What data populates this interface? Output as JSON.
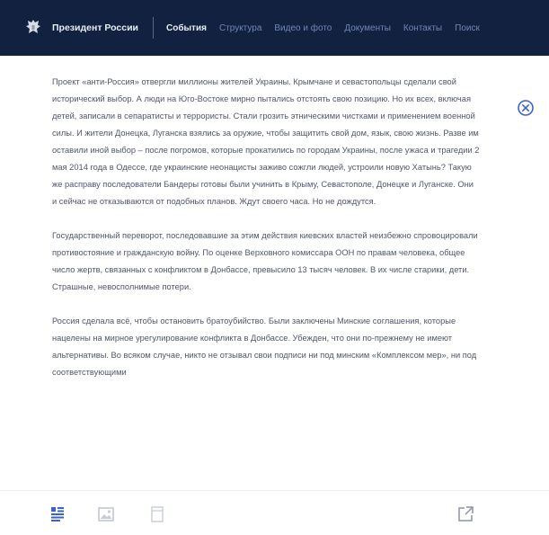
{
  "header": {
    "site_title": "Президент России",
    "nav": [
      {
        "label": "События",
        "active": true
      },
      {
        "label": "Структура",
        "active": false
      },
      {
        "label": "Видео и фото",
        "active": false
      },
      {
        "label": "Документы",
        "active": false
      },
      {
        "label": "Контакты",
        "active": false
      },
      {
        "label": "Поиск",
        "active": false
      }
    ]
  },
  "article": {
    "paragraphs": [
      "Проект «анти-Россия» отвергли миллионы жителей Украины. Крымчане и севастопольцы сделали свой исторический выбор. А люди на Юго-Востоке мирно пытались отстоять свою позицию. Но их всех, включая детей, записали в сепаратисты и террористы. Стали грозить этническими чистками и применением военной силы. И жители Донецка, Луганска взялись за оружие, чтобы защитить свой дом, язык, свою жизнь. Разве им оставили иной выбор – после погромов, которые прокатились по городам Украины, после ужаса и трагедии 2 мая 2014 года в Одессе, где украинские неонацисты заживо сожгли людей, устроили новую Хатынь? Такую же расправу последователи Бандеры готовы были учинить в Крыму, Севастополе, Донецке и Луганске. Они и сейчас не отказываются от подобных планов. Ждут своего часа. Но не дождутся.",
      "Государственный переворот, последовавшие за этим действия киевских властей неизбежно спровоцировали противостояние и гражданскую войну. По оценке Верховного комиссара ООН по правам человека, общее число жертв, связанных с конфликтом в Донбассе, превысило 13 тысяч человек. В их числе старики, дети. Страшные, невосполнимые потери.",
      "Россия сделала всё, чтобы остановить братоубийство. Были заключены Минские соглашения, которые нацелены на мирное урегулирование конфликта в Донбассе. Убежден, что они по-прежнему не имеют альтернативы. Во всяком случае, никто не отзывал свои подписи ни под минским «Комплексом мер», ни под соответствующими"
    ]
  },
  "colors": {
    "header_bg": "#11213f",
    "accent": "#3d63c9"
  },
  "icons": {
    "emblem": "double-headed-eagle-emblem",
    "close": "close-circle-icon",
    "text_view": "text-view-icon",
    "image_view": "image-view-icon",
    "page_view": "page-view-icon",
    "share": "share-icon"
  }
}
